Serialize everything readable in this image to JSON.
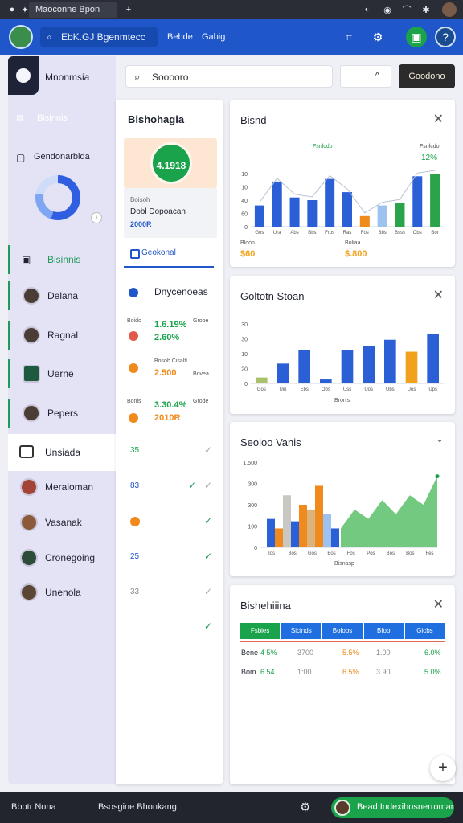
{
  "os": {
    "tab_title": "Maoconne Bpon",
    "icons": [
      "dot-icon",
      "gear-icon",
      "plus-icon",
      "wifi-icon",
      "battery-icon"
    ]
  },
  "header": {
    "search_text": "EbK.GJ Bgenmtecc",
    "link1": "Bebde",
    "link2": "Gabig"
  },
  "sidebar": {
    "brand": "Mnonmsia",
    "section": "Bisinnis",
    "donut_label": "Gendonarbida",
    "items": [
      {
        "label": "Bisinnis",
        "kind": "icon"
      },
      {
        "label": "Delana",
        "kind": "avatar"
      },
      {
        "label": "Ragnal",
        "kind": "avatar"
      },
      {
        "label": "Uerne",
        "kind": "avatar"
      },
      {
        "label": "Pepers",
        "kind": "avatar"
      },
      {
        "label": "Unsiada",
        "kind": "icon"
      },
      {
        "label": "Meraloman",
        "kind": "avatar"
      },
      {
        "label": "Vasanak",
        "kind": "avatar"
      },
      {
        "label": "Cronegoing",
        "kind": "avatar"
      },
      {
        "label": "Unenola",
        "kind": "avatar"
      }
    ]
  },
  "middle": {
    "title": "Bishohagia",
    "gauge_value": "4.1918",
    "sub_label": "Boisoh",
    "sub_title": "Dobl Dopoacan",
    "sub_value": "2000R",
    "tab": "Geokonal",
    "section": "Dnycenoeas",
    "metrics": [
      {
        "label": "Boido",
        "value": "1.6.19%",
        "value2": "2.60%",
        "side": "Grobe",
        "color": "#1aa34a",
        "dot": "#e2584a"
      },
      {
        "label": "Bosob Cisaltl",
        "value": "2.500",
        "value2": "",
        "side": "Bovea",
        "color": "#f08a1c",
        "dot": "#f08a1c"
      },
      {
        "label": "Bonis",
        "value": "3.30.4%",
        "value2": "2010R",
        "side": "Grode",
        "color": "#1aa34a",
        "dot": "#f08a1c"
      }
    ],
    "list": [
      {
        "value": "35",
        "color": "#1aa34a"
      },
      {
        "value": "83",
        "color": "#1f56c9"
      },
      {
        "value": "",
        "color": "#f08a1c"
      },
      {
        "value": "25",
        "color": "#1f56c9"
      },
      {
        "value": "33",
        "color": "#888888"
      }
    ]
  },
  "top": {
    "search_text": "Sooooro",
    "button": "Goodono"
  },
  "panel1": {
    "title": "Bisnd",
    "legend": "Fsnlcdo",
    "pct": "12%",
    "foot_left": "Bloon",
    "foot_left_val": "$60",
    "foot_right": "Boliaa",
    "foot_right_val": "$.800"
  },
  "panel2": {
    "title": "Goltotn Stoan",
    "xlabel": "Brorrs"
  },
  "panel3": {
    "title": "Seoloo Vanis",
    "xlabel": "Bisnasp"
  },
  "panel4": {
    "title": "Bishehiiina",
    "headers": [
      "Fsbies",
      "Sicinds",
      "Bolobs",
      "Bfoo",
      "Gicbs"
    ],
    "rows": [
      {
        "a": "Bene",
        "b": "4 5%",
        "c": "3700",
        "d": "5.5%",
        "e": "1.00",
        "f": "6.0%"
      },
      {
        "a": "Bom",
        "b": "6 54",
        "c": "1:00",
        "d": "6.5%",
        "e": "3.90",
        "f": "5.0%"
      }
    ]
  },
  "bottom": {
    "left": "Bbotr Nona",
    "middle": "Bsosgine Bhonkang",
    "pill": "Bead Indexihosnerroman"
  },
  "chart_data": [
    {
      "type": "bar",
      "categories": [
        "Gos",
        "Ura",
        "Abs",
        "Bbs",
        "Fros",
        "Ras",
        "Fos",
        "Bbs",
        "Bsss",
        "Obs",
        "Bor"
      ],
      "series": [
        {
          "name": "",
          "values": [
            8,
            17,
            11,
            10,
            18,
            13,
            4,
            8,
            9,
            19,
            20
          ]
        }
      ],
      "yticks": [
        "0",
        "60",
        "40",
        "10",
        "10"
      ],
      "ylim": [
        0,
        20
      ]
    },
    {
      "type": "bar",
      "categories": [
        "Gos",
        "Uin",
        "Ebs",
        "Obs",
        "Uss",
        "Uos",
        "Ubs",
        "Uos",
        "Ups"
      ],
      "series": [
        {
          "name": "",
          "values": [
            3,
            10,
            17,
            2,
            17,
            19,
            22,
            16,
            25
          ]
        }
      ],
      "yticks": [
        "0",
        "20",
        "10",
        "30",
        "30"
      ],
      "ylim": [
        0,
        30
      ]
    },
    {
      "type": "bar",
      "categories": [
        "Ios",
        "Bos",
        "Gos",
        "Bos",
        "Fos",
        "Pos",
        "Bos",
        "Bos",
        "Fes"
      ],
      "series": [
        {
          "name": "",
          "values": [
            60,
            40,
            110,
            55,
            90,
            80,
            130,
            70,
            40
          ]
        }
      ],
      "area": [
        40,
        80,
        60,
        100,
        70,
        110,
        90,
        150
      ],
      "yticks": [
        "0",
        "100",
        "300",
        "300",
        "1.500"
      ],
      "ylim": [
        0,
        180
      ]
    }
  ]
}
